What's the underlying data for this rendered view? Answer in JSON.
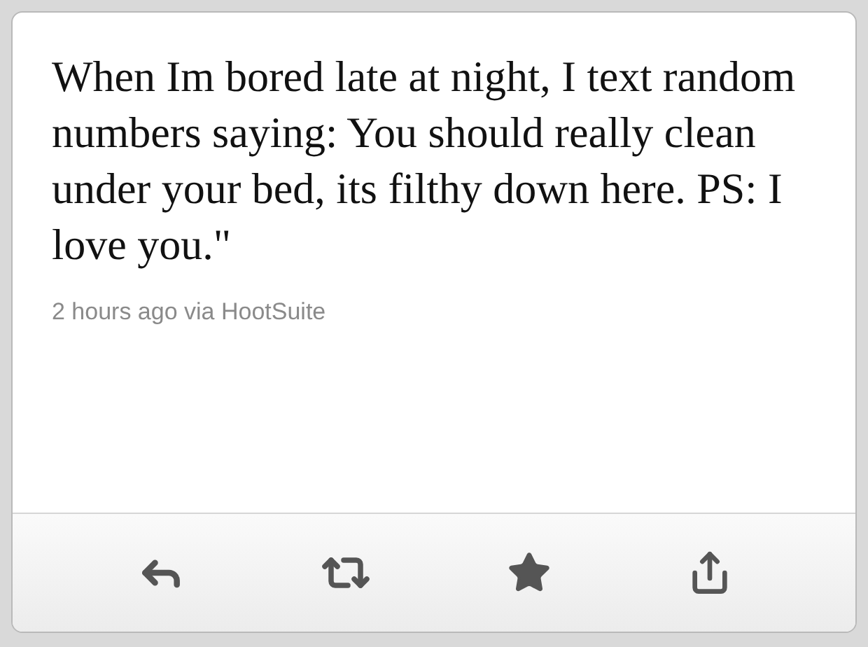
{
  "tweet": {
    "text": "When Im bored late at night, I text random numbers saying: You should really clean under your bed, its filthy down here. PS: I love you.\"",
    "meta": "2 hours ago via HootSuite"
  },
  "actions": [
    {
      "kind": "reply"
    },
    {
      "kind": "retweet"
    },
    {
      "kind": "favorite"
    },
    {
      "kind": "share"
    }
  ]
}
